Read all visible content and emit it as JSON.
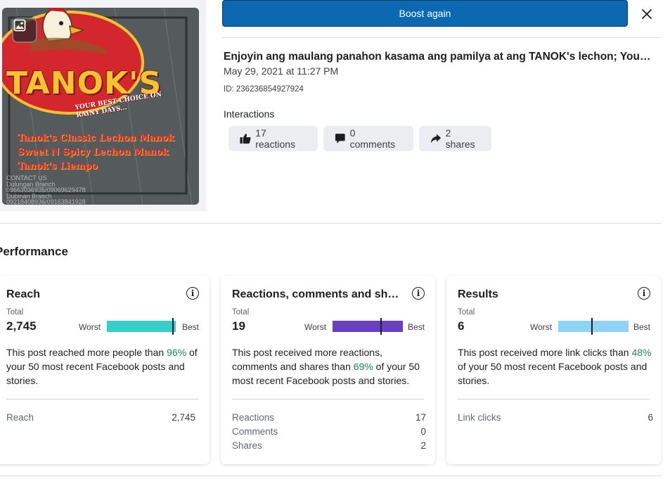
{
  "thumbnail": {
    "brand": "TANOK'S",
    "tagline": "YOUR BEST CHOICE ON RAINY DAYS...",
    "menu": [
      "Tanok's Classic Lechon Manok",
      "Sweet N Spicy Lechon Manok",
      "Tanok's Liempo"
    ],
    "contact_lines": [
      "CONTACT US",
      "Dulungan Branch",
      "09663036935/09069629478",
      "Dubinan Branch",
      "09218408936/09163841928"
    ],
    "badge_icon": "photo-icon"
  },
  "actions": {
    "boost_label": "Boost again",
    "close_icon": "close-icon"
  },
  "post": {
    "title": "Enjoyin ang maulang panahon kasama ang pamilya at ang TANOK's lechon; You can order anytime",
    "date": "May 29, 2021 at 11:27 PM",
    "id": "ID: 236236854927924",
    "interactions_label": "Interactions",
    "chips": [
      {
        "icon": "thumbs-up-icon",
        "label": "17 reactions"
      },
      {
        "icon": "comment-icon",
        "label": "0 comments"
      },
      {
        "icon": "share-icon",
        "label": "2 shares"
      }
    ]
  },
  "performance": {
    "title": "Performance",
    "cards": [
      {
        "title": "Reach",
        "total_label": "Total",
        "total": "2,745",
        "worst": "Worst",
        "best": "Best",
        "bar_color": "#36cfc9",
        "marker_fraction": 0.96,
        "desc_before": "This post reached more people than ",
        "desc_pct": "96%",
        "desc_after": " of your 50 most recent Facebook posts and stories.",
        "metrics": [
          {
            "label": "Reach",
            "value": "2,745"
          }
        ]
      },
      {
        "title": "Reactions, comments and shares",
        "total_label": "Total",
        "total": "19",
        "worst": "Worst",
        "best": "Best",
        "bar_color": "#6a3fc1",
        "marker_fraction": 0.69,
        "desc_before": "This post received more reactions, comments and shares than ",
        "desc_pct": "69%",
        "desc_after": " of your 50 most recent Facebook posts and stories.",
        "metrics": [
          {
            "label": "Reactions",
            "value": "17"
          },
          {
            "label": "Comments",
            "value": "0"
          },
          {
            "label": "Shares",
            "value": "2"
          }
        ]
      },
      {
        "title": "Results",
        "total_label": "Total",
        "total": "6",
        "worst": "Worst",
        "best": "Best",
        "bar_color": "#8ed4f7",
        "marker_fraction": 0.48,
        "desc_before": "This post received more link clicks than ",
        "desc_pct": "48%",
        "desc_after": " of your 50 most recent Facebook posts and stories.",
        "metrics": [
          {
            "label": "Link clicks",
            "value": "6"
          }
        ]
      }
    ]
  }
}
